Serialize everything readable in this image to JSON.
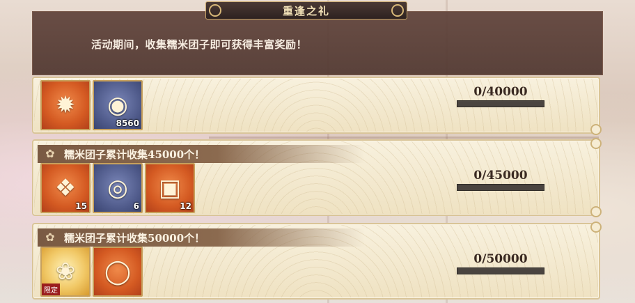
{
  "event": {
    "title": "重逢之礼",
    "description": "活动期间，收集糯米团子即可获得丰富奖励！"
  },
  "tasks": [
    {
      "title": "",
      "rewards": [
        {
          "icon": "charm-icon",
          "glyph": "✹",
          "style": "orange",
          "qty": ""
        },
        {
          "icon": "coin-icon",
          "glyph": "◉",
          "style": "blue",
          "qty": "8560"
        }
      ],
      "progress_text": "0/40000",
      "progress_fraction": 0
    },
    {
      "title": "糯米团子累计收集45000个！",
      "rewards": [
        {
          "icon": "talisman-icon",
          "glyph": "❖",
          "style": "orange",
          "qty": "15"
        },
        {
          "icon": "eye-demon-icon",
          "glyph": "◎",
          "style": "blue",
          "qty": "6"
        },
        {
          "icon": "gift-box-icon",
          "glyph": "▣",
          "style": "orange",
          "qty": "12"
        }
      ],
      "progress_text": "0/45000",
      "progress_fraction": 0
    },
    {
      "title": "糯米团子累计收集50000个！",
      "rewards": [
        {
          "icon": "card-icon",
          "glyph": "❀",
          "style": "gold",
          "qty": "",
          "badge": "限定"
        },
        {
          "icon": "mirror-icon",
          "glyph": "◯",
          "style": "orange",
          "qty": ""
        }
      ],
      "progress_text": "0/50000",
      "progress_fraction": 0
    }
  ]
}
